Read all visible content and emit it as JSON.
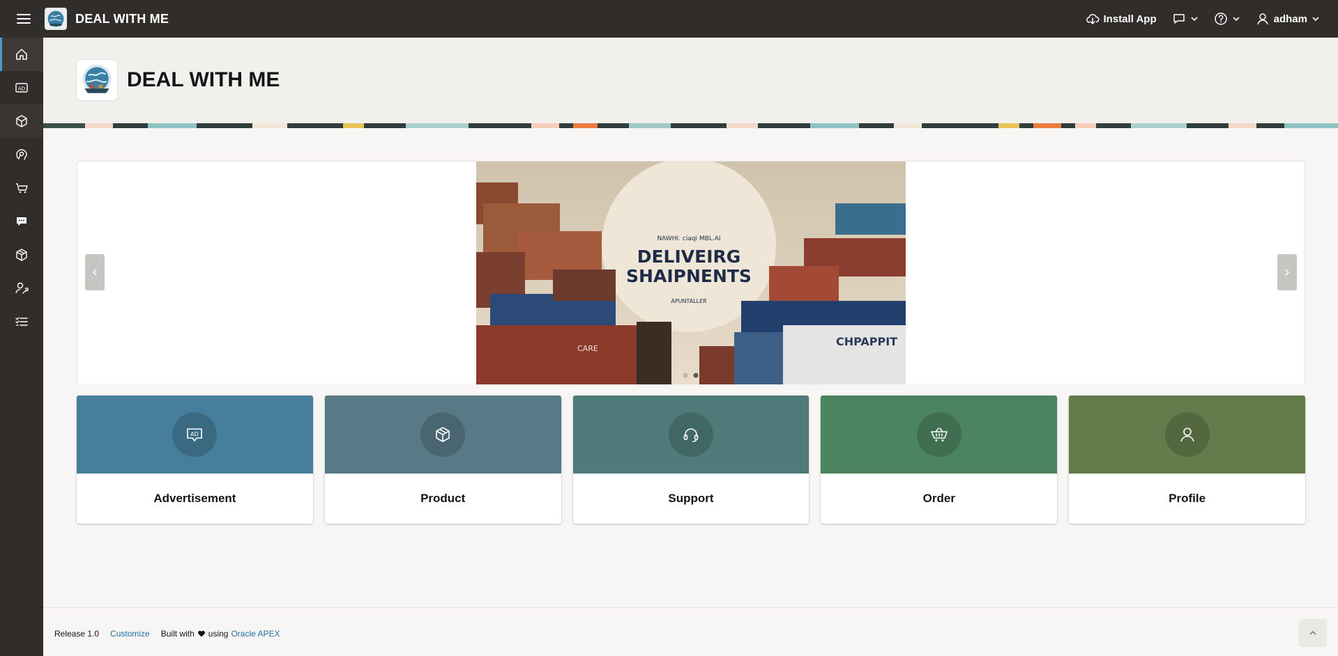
{
  "header": {
    "app_title": "DEAL WITH ME",
    "install_label": "Install App",
    "user_name": "adham",
    "background": "#312d2a"
  },
  "sidenav": {
    "items": [
      {
        "icon": "home-icon",
        "active": true
      },
      {
        "icon": "ad-icon"
      },
      {
        "icon": "cube-icon"
      },
      {
        "icon": "support-icon"
      },
      {
        "icon": "cart-icon"
      },
      {
        "icon": "chat-icon"
      },
      {
        "icon": "package-icon"
      },
      {
        "icon": "user-settings-icon"
      },
      {
        "icon": "list-icon"
      }
    ]
  },
  "hero": {
    "title": "DEAL WITH ME"
  },
  "carousel": {
    "slide_heading_line1": "DELIVEIRG",
    "slide_heading_line2": "SHAIPNENTS",
    "slide_top_text": "NAWHI. ciaqi MBL.AI",
    "slide_sub_text": "APUNTALLER",
    "slide_left_container_text": "CARE",
    "slide_right_container_text": "CHPAPPIT",
    "slide_count": 2,
    "active_slide": 2
  },
  "cards": [
    {
      "label": "Advertisement",
      "icon": "ad-icon",
      "color": "#457f9b"
    },
    {
      "label": "Product",
      "icon": "cube-icon",
      "color": "#587986"
    },
    {
      "label": "Support",
      "icon": "headset-icon",
      "color": "#4f7c7a"
    },
    {
      "label": "Order",
      "icon": "cart-icon",
      "color": "#4d8460"
    },
    {
      "label": "Profile",
      "icon": "user-icon",
      "color": "#647c4c"
    }
  ],
  "footer": {
    "release": "Release 1.0",
    "customize": "Customize",
    "built_with": "Built with",
    "using": "using",
    "oracle_apex": "Oracle APEX"
  }
}
